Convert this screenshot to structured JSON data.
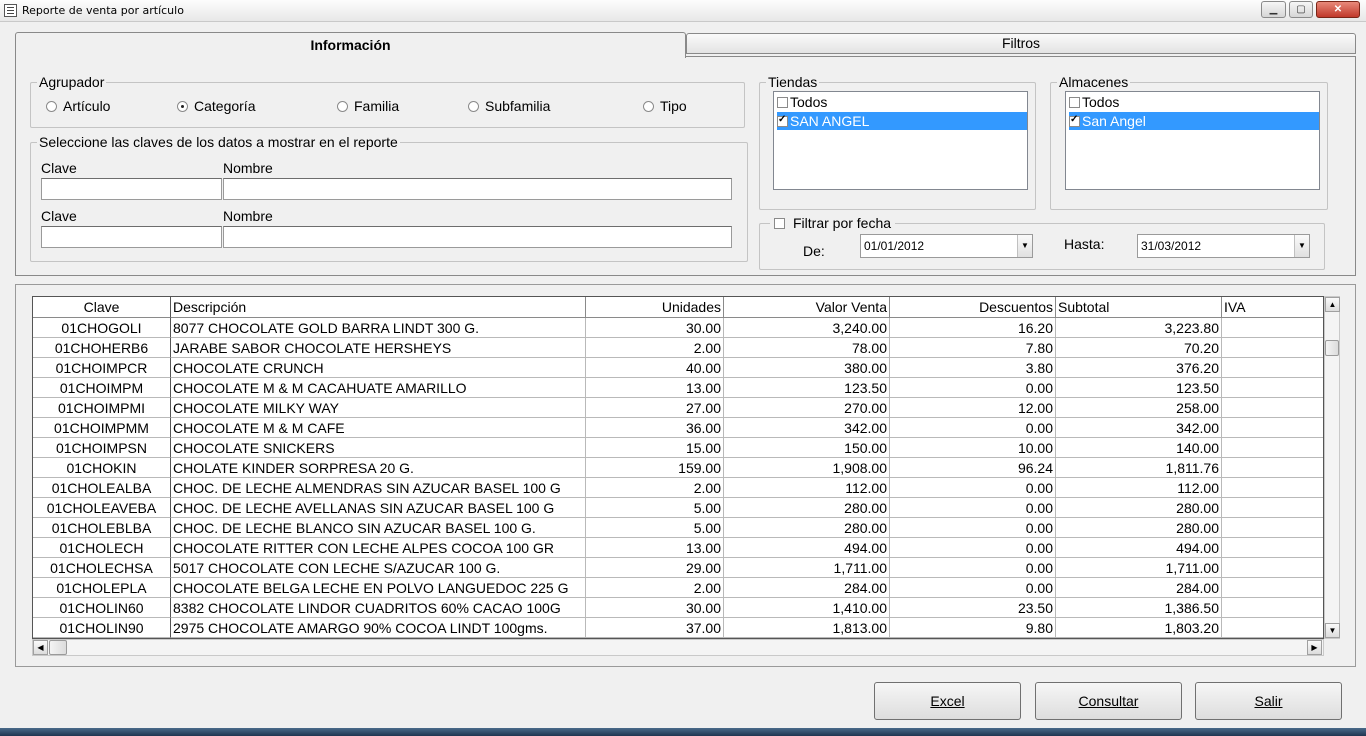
{
  "window": {
    "title": "Reporte de venta por artículo",
    "min_label": "▁",
    "max_label": "▢",
    "close_label": "✕"
  },
  "tabs": [
    {
      "label": "Información"
    },
    {
      "label": "Filtros"
    }
  ],
  "agrupador": {
    "legend": "Agrupador",
    "options": [
      {
        "label": "Artículo",
        "selected": false
      },
      {
        "label": "Categoría",
        "selected": true
      },
      {
        "label": "Familia",
        "selected": false
      },
      {
        "label": "Subfamilia",
        "selected": false
      },
      {
        "label": "Tipo",
        "selected": false
      }
    ]
  },
  "claves": {
    "legend": "Seleccione las claves de los datos a mostrar en el reporte",
    "rows": [
      {
        "clave_label": "Clave",
        "nombre_label": "Nombre",
        "clave_value": "",
        "nombre_value": ""
      },
      {
        "clave_label": "Clave",
        "nombre_label": "Nombre",
        "clave_value": "",
        "nombre_value": ""
      }
    ]
  },
  "tiendas": {
    "legend": "Tiendas",
    "items": [
      {
        "label": "Todos",
        "checked": false,
        "selected": false
      },
      {
        "label": "SAN ANGEL",
        "checked": true,
        "selected": true
      }
    ]
  },
  "almacenes": {
    "legend": "Almacenes",
    "items": [
      {
        "label": "Todos",
        "checked": false,
        "selected": false
      },
      {
        "label": "San Angel",
        "checked": true,
        "selected": true
      }
    ]
  },
  "fecha": {
    "filter_label": "Filtrar por fecha",
    "filter_checked": false,
    "de_label": "De:",
    "de_value": "01/01/2012",
    "hasta_label": "Hasta:",
    "hasta_value": "31/03/2012"
  },
  "grid": {
    "columns": [
      "Clave",
      "Descripción",
      "Unidades",
      "Valor Venta",
      "Descuentos",
      "Subtotal",
      "IVA"
    ],
    "rows": [
      [
        "01CHOGOLI",
        "8077 CHOCOLATE GOLD BARRA LINDT 300 G.",
        "30.00",
        "3,240.00",
        "16.20",
        "3,223.80",
        ""
      ],
      [
        "01CHOHERB6",
        "JARABE SABOR CHOCOLATE HERSHEYS",
        "2.00",
        "78.00",
        "7.80",
        "70.20",
        ""
      ],
      [
        "01CHOIMPCR",
        "CHOCOLATE CRUNCH",
        "40.00",
        "380.00",
        "3.80",
        "376.20",
        ""
      ],
      [
        "01CHOIMPM",
        "CHOCOLATE M & M CACAHUATE AMARILLO",
        "13.00",
        "123.50",
        "0.00",
        "123.50",
        ""
      ],
      [
        "01CHOIMPMI",
        "CHOCOLATE MILKY WAY",
        "27.00",
        "270.00",
        "12.00",
        "258.00",
        ""
      ],
      [
        "01CHOIMPMM",
        "CHOCOLATE M & M CAFE",
        "36.00",
        "342.00",
        "0.00",
        "342.00",
        ""
      ],
      [
        "01CHOIMPSN",
        "CHOCOLATE SNICKERS",
        "15.00",
        "150.00",
        "10.00",
        "140.00",
        ""
      ],
      [
        "01CHOKIN",
        "CHOLATE KINDER SORPRESA 20 G.",
        "159.00",
        "1,908.00",
        "96.24",
        "1,811.76",
        ""
      ],
      [
        "01CHOLEALBA",
        "CHOC. DE LECHE ALMENDRAS SIN AZUCAR BASEL 100 G",
        "2.00",
        "112.00",
        "0.00",
        "112.00",
        ""
      ],
      [
        "01CHOLEAVEBA",
        "CHOC. DE LECHE AVELLANAS SIN AZUCAR BASEL 100 G",
        "5.00",
        "280.00",
        "0.00",
        "280.00",
        ""
      ],
      [
        "01CHOLEBLBA",
        "CHOC. DE LECHE BLANCO SIN AZUCAR BASEL 100 G.",
        "5.00",
        "280.00",
        "0.00",
        "280.00",
        ""
      ],
      [
        "01CHOLECH",
        "CHOCOLATE RITTER CON LECHE ALPES COCOA 100 GR",
        "13.00",
        "494.00",
        "0.00",
        "494.00",
        ""
      ],
      [
        "01CHOLECHSA",
        "5017 CHOCOLATE CON LECHE S/AZUCAR 100 G.",
        "29.00",
        "1,711.00",
        "0.00",
        "1,711.00",
        ""
      ],
      [
        "01CHOLEPLA",
        "CHOCOLATE BELGA LECHE EN POLVO LANGUEDOC 225 G",
        "2.00",
        "284.00",
        "0.00",
        "284.00",
        ""
      ],
      [
        "01CHOLIN60",
        "8382 CHOCOLATE LINDOR CUADRITOS 60% CACAO 100G",
        "30.00",
        "1,410.00",
        "23.50",
        "1,386.50",
        ""
      ],
      [
        "01CHOLIN90",
        "2975 CHOCOLATE AMARGO 90% COCOA LINDT 100gms.",
        "37.00",
        "1,813.00",
        "9.80",
        "1,803.20",
        ""
      ]
    ]
  },
  "buttons": {
    "excel": "Excel",
    "consultar": "Consultar",
    "salir": "Salir"
  },
  "icons": {
    "scroll_up": "▲",
    "scroll_down": "▼",
    "scroll_left": "◀",
    "scroll_right": "▶",
    "combo_arrow": "▼"
  }
}
